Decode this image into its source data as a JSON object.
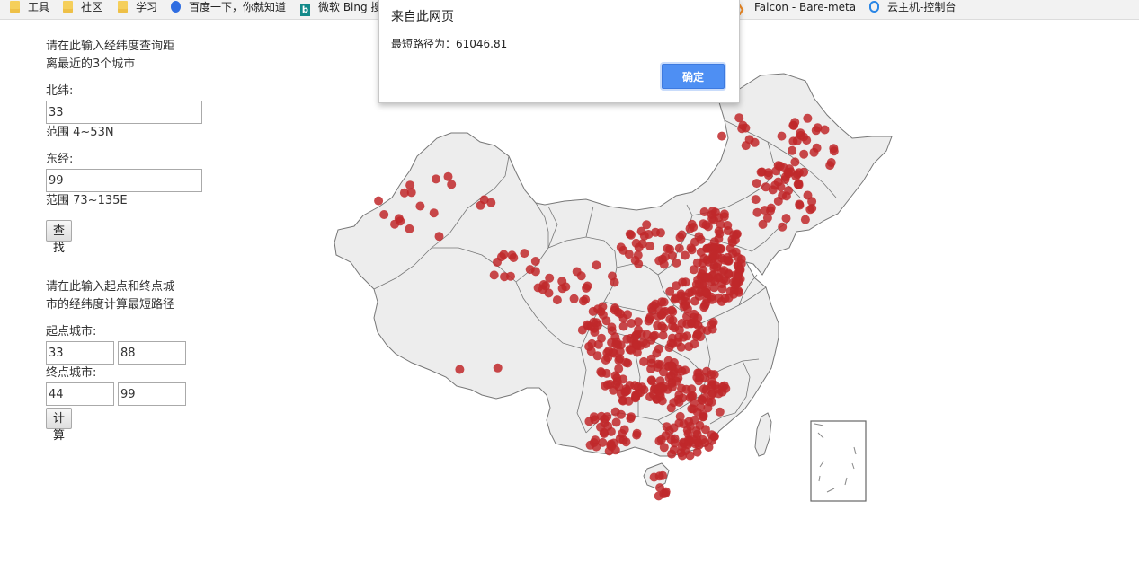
{
  "bookmarks": [
    {
      "label": "工具",
      "icon": "folder-icon"
    },
    {
      "label": "社区",
      "icon": "folder-icon"
    },
    {
      "label": "学习",
      "icon": "folder-icon"
    },
    {
      "label": "百度一下，你就知道",
      "icon": "baidu-icon"
    },
    {
      "label": "微软 Bing 搜",
      "icon": "bing-icon"
    },
    {
      "label": "Falcon - Bare-metal",
      "icon": "falcon-icon"
    },
    {
      "label": "云主机-控制台",
      "icon": "cloud-icon"
    }
  ],
  "nearest": {
    "intro": [
      "请在此输入经纬度查询距",
      "离最近的3个城市"
    ],
    "lat_label": "北纬:",
    "lat_value": "33",
    "lat_range": "范围 4~53N",
    "lon_label": "东经:",
    "lon_value": "99",
    "lon_range": "范围 73~135E",
    "button": "查找"
  },
  "route": {
    "intro": [
      "请在此输入起点和终点城",
      "市的经纬度计算最短路径"
    ],
    "start_label": "起点城市:",
    "start_lat": "33",
    "start_lon": "88",
    "end_label": "终点城市:",
    "end_lat": "44",
    "end_lon": "99",
    "button": "计算"
  },
  "dialog": {
    "title": "来自此网页",
    "message": "最短路径为：61046.81",
    "ok": "确定"
  },
  "map": {
    "land_color": "#ededed",
    "border_color": "#777777",
    "point_color": "#c0282a"
  }
}
